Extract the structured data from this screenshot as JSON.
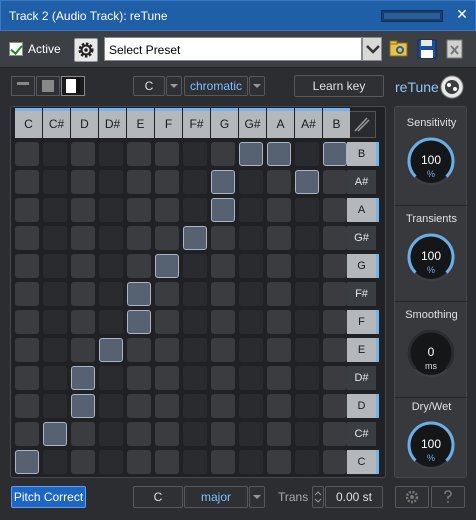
{
  "window": {
    "title": "Track 2 (Audio Track): reTune",
    "close_glyph": "✕"
  },
  "toolbar": {
    "active_label": "Active",
    "active_checked": true,
    "preset_value": "Select Preset",
    "icons": [
      "gear-icon",
      "chevron-down-icon",
      "folder-open-icon",
      "save-icon",
      "delete-icon"
    ]
  },
  "controls": {
    "key": "C",
    "mode": "chromatic",
    "learn_key": "Learn key",
    "brand": "reTune"
  },
  "grid": {
    "columns": [
      "C",
      "C#",
      "D",
      "D#",
      "E",
      "F",
      "F#",
      "G",
      "G#",
      "A",
      "A#",
      "B"
    ],
    "black_keys": [
      "C#",
      "D#",
      "F#",
      "G#",
      "A#"
    ],
    "rows": [
      "B",
      "A#",
      "A",
      "G#",
      "G",
      "F#",
      "F",
      "E",
      "D#",
      "D",
      "C#",
      "C"
    ],
    "active_cells": [
      [
        0,
        11
      ],
      [
        1,
        10
      ],
      [
        2,
        9
      ],
      [
        2,
        8
      ],
      [
        3,
        7
      ],
      [
        4,
        6
      ],
      [
        4,
        5
      ],
      [
        5,
        4
      ],
      [
        6,
        3
      ],
      [
        7,
        2
      ],
      [
        7,
        1
      ],
      [
        8,
        0
      ],
      [
        9,
        0
      ],
      [
        10,
        1
      ],
      [
        11,
        0
      ]
    ]
  },
  "knobs": [
    {
      "label": "Sensitivity",
      "value": "100",
      "unit": "%",
      "level": 1.0
    },
    {
      "label": "Transients",
      "value": "100",
      "unit": "%",
      "level": 1.0
    },
    {
      "label": "Smoothing",
      "value": "0",
      "unit": "ms",
      "level": 0.0
    },
    {
      "label": "Dry/Wet",
      "value": "100",
      "unit": "%",
      "level": 1.0
    }
  ],
  "footer": {
    "pitch_correct": "Pitch Correct",
    "scale_key": "C",
    "scale_mode": "major",
    "trans_label": "Trans",
    "trans_value": "0.00 st"
  },
  "colors": {
    "title_bar": "#1f5fa8",
    "accent": "#76b4ec",
    "active_cell": "#566171"
  }
}
